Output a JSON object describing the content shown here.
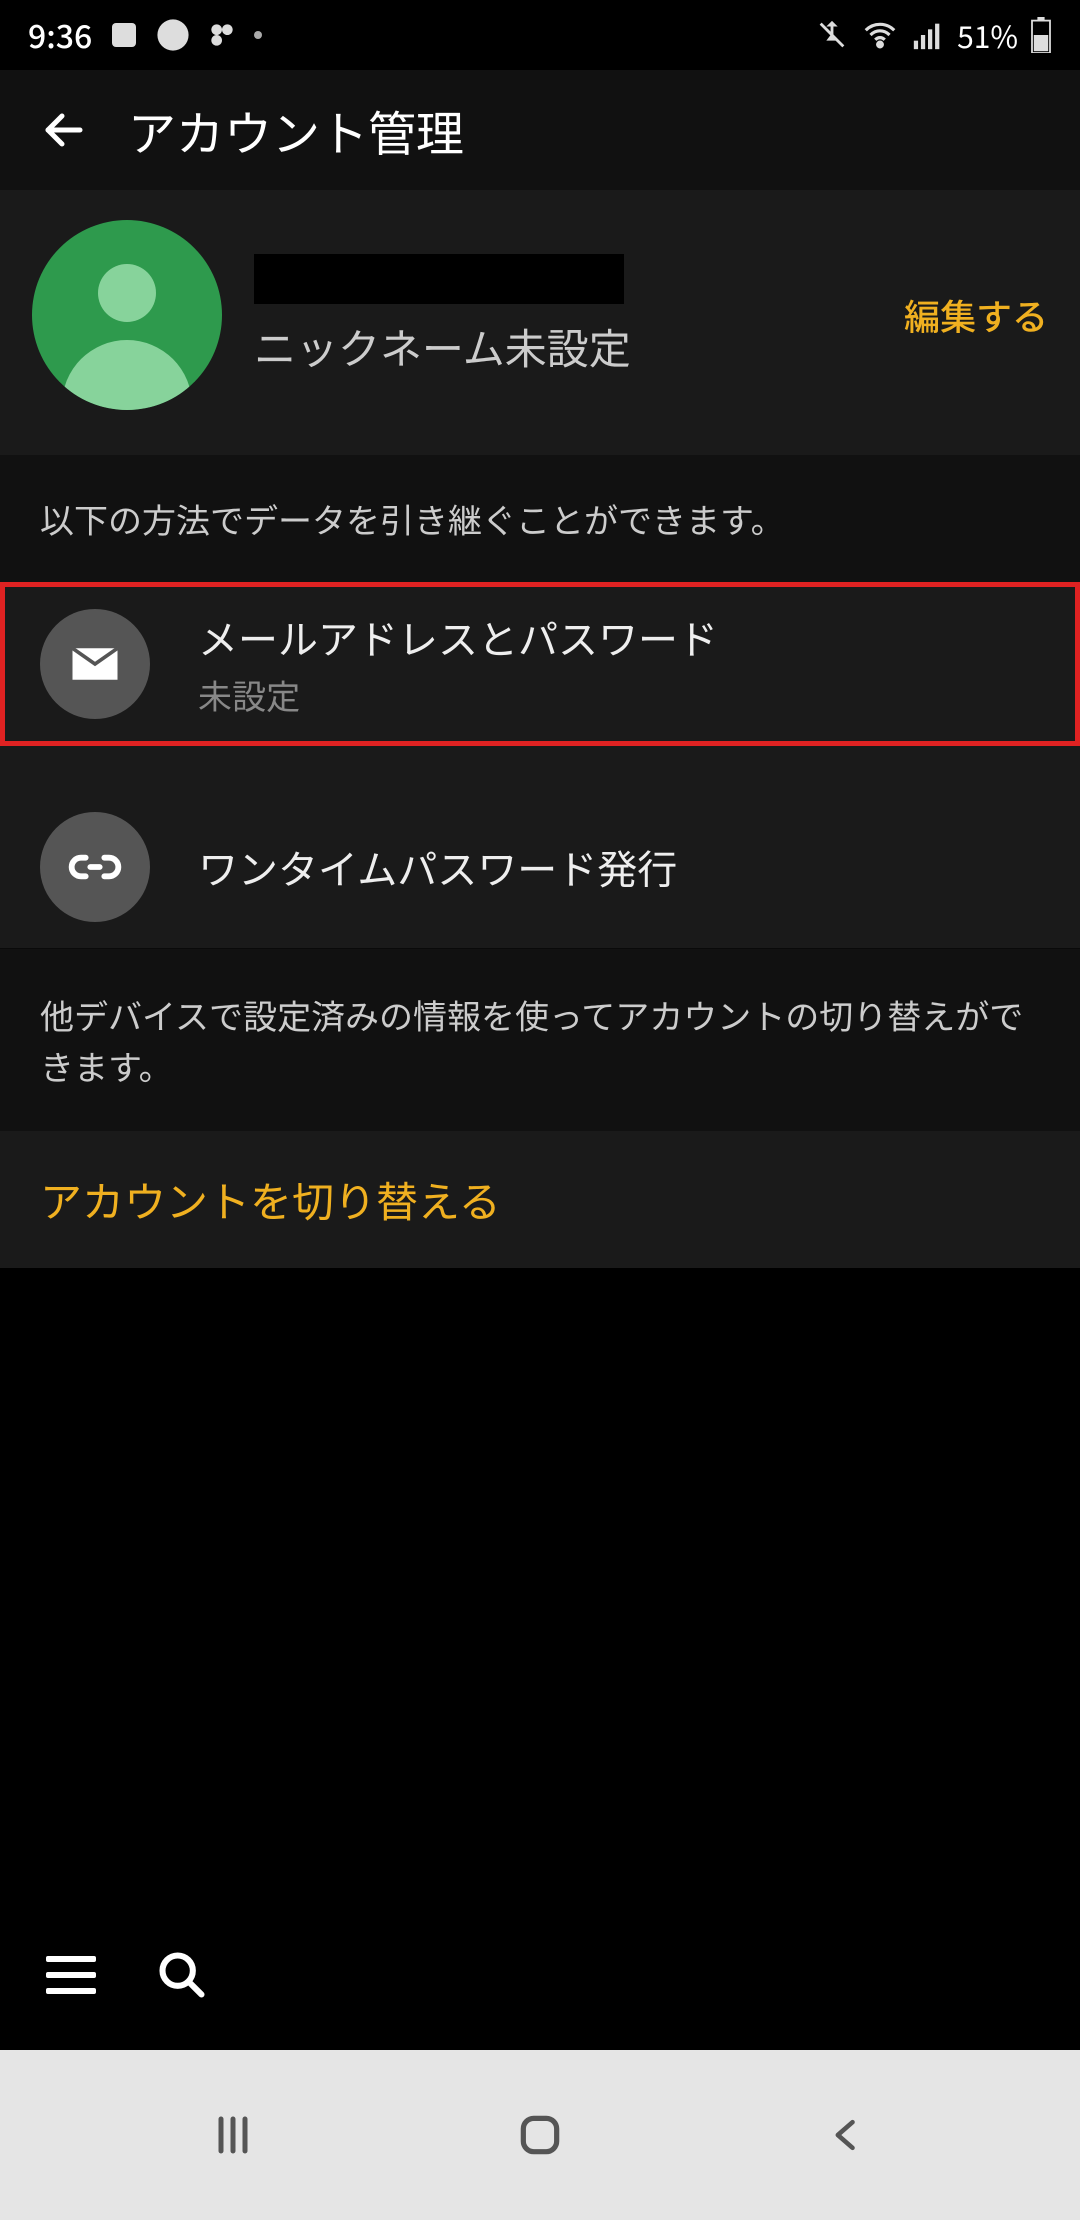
{
  "status": {
    "time": "9:36",
    "battery_pct": "51%"
  },
  "header": {
    "title": "アカウント管理"
  },
  "profile": {
    "nickname": "ニックネーム未設定",
    "edit_label": "編集する"
  },
  "section1": {
    "desc": "以下の方法でデータを引き継ぐことができます。"
  },
  "options": {
    "email": {
      "title": "メールアドレスとパスワード",
      "sub": "未設定"
    },
    "onetime": {
      "title": "ワンタイムパスワード発行"
    }
  },
  "section2": {
    "desc": "他デバイスで設定済みの情報を使ってアカウントの切り替えができます。"
  },
  "switch_account_label": "アカウントを切り替える"
}
